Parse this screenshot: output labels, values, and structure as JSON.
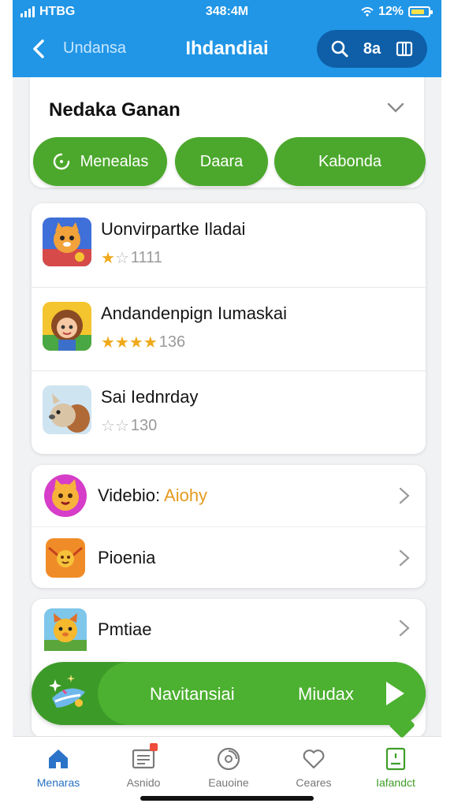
{
  "status_bar": {
    "carrier": "HTBG",
    "time": "348:4M",
    "battery": "12%"
  },
  "nav": {
    "back_label": "Undansa",
    "title": "Ihdandiai",
    "pill_text": "8a"
  },
  "section": {
    "title": "Nedaka Ganan",
    "chips": [
      {
        "label": "Menealas"
      },
      {
        "label": "Daara"
      },
      {
        "label": "Kabonda"
      }
    ]
  },
  "apps": [
    {
      "title": "Uonvirpartke Iladai",
      "stars": 1,
      "rating_count": "1111",
      "icon": "cat-hero-icon"
    },
    {
      "title": "Andandenpign Iumaskai",
      "stars": 4,
      "rating_count": "136",
      "icon": "girl-character-icon"
    },
    {
      "title": "Sai Iednrday",
      "stars": 0,
      "rating_count": "130",
      "icon": "squirrel-icon"
    }
  ],
  "menu": {
    "items": [
      {
        "label": "Videbio:",
        "accent": "Aiohy",
        "icon": "pink-cat-icon"
      },
      {
        "label": "Pioenia",
        "accent": "",
        "icon": "orange-envelope-icon"
      }
    ]
  },
  "third": {
    "label": "Pmtiae",
    "icon": "fox-icon"
  },
  "banner": {
    "left_text": "Navitansiai",
    "right_text": "Miudax"
  },
  "bottom_tabs": [
    {
      "label": "Menaras",
      "icon": "home-icon"
    },
    {
      "label": "Asnido",
      "icon": "news-icon"
    },
    {
      "label": "Eauoine",
      "icon": "disc-icon"
    },
    {
      "label": "Ceares",
      "icon": "heart-icon"
    },
    {
      "label": "Iafandct",
      "icon": "book-icon"
    }
  ],
  "colors": {
    "header_blue": "#2196e6",
    "pill_dark": "#0e5fa8",
    "green": "#4ca82c",
    "star_gold": "#f0a91b"
  }
}
